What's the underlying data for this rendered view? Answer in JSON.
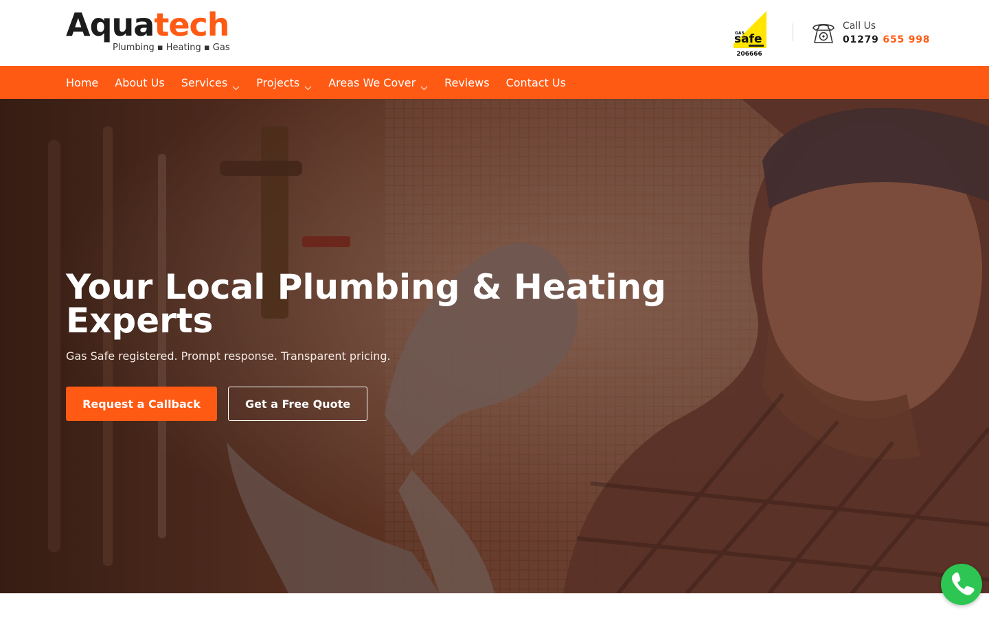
{
  "header": {
    "logo": {
      "word_dark": "Aqua",
      "word_orange": "tech",
      "tagline": "Plumbing ▪ Heating ▪ Gas"
    },
    "gas_safe": {
      "brand": "safe",
      "prefix": "GAS",
      "number": "206666"
    },
    "call": {
      "label": "Call Us",
      "number_prefix": "01279",
      "number_main": "655 998"
    }
  },
  "nav": {
    "items": [
      {
        "label": "Home",
        "has_dropdown": false
      },
      {
        "label": "About Us",
        "has_dropdown": false
      },
      {
        "label": "Services",
        "has_dropdown": true
      },
      {
        "label": "Projects",
        "has_dropdown": true
      },
      {
        "label": "Areas We Cover",
        "has_dropdown": true
      },
      {
        "label": "Reviews",
        "has_dropdown": false
      },
      {
        "label": "Contact Us",
        "has_dropdown": false
      }
    ]
  },
  "hero": {
    "title": "Your Local Plumbing & Heating Experts",
    "subtitle": "Gas Safe registered. Prompt response. Transparent pricing.",
    "primary_cta": "Request a Callback",
    "secondary_cta": "Get a Free Quote"
  },
  "colors": {
    "accent": "#ff5a14",
    "dark": "#1c1c1c",
    "gas_safe_yellow": "#ffe500",
    "call_fab": "#2dc653"
  },
  "icons": {
    "phone": "telephone-icon",
    "fab": "phone-call-icon",
    "chevron": "chevron-down-icon"
  }
}
